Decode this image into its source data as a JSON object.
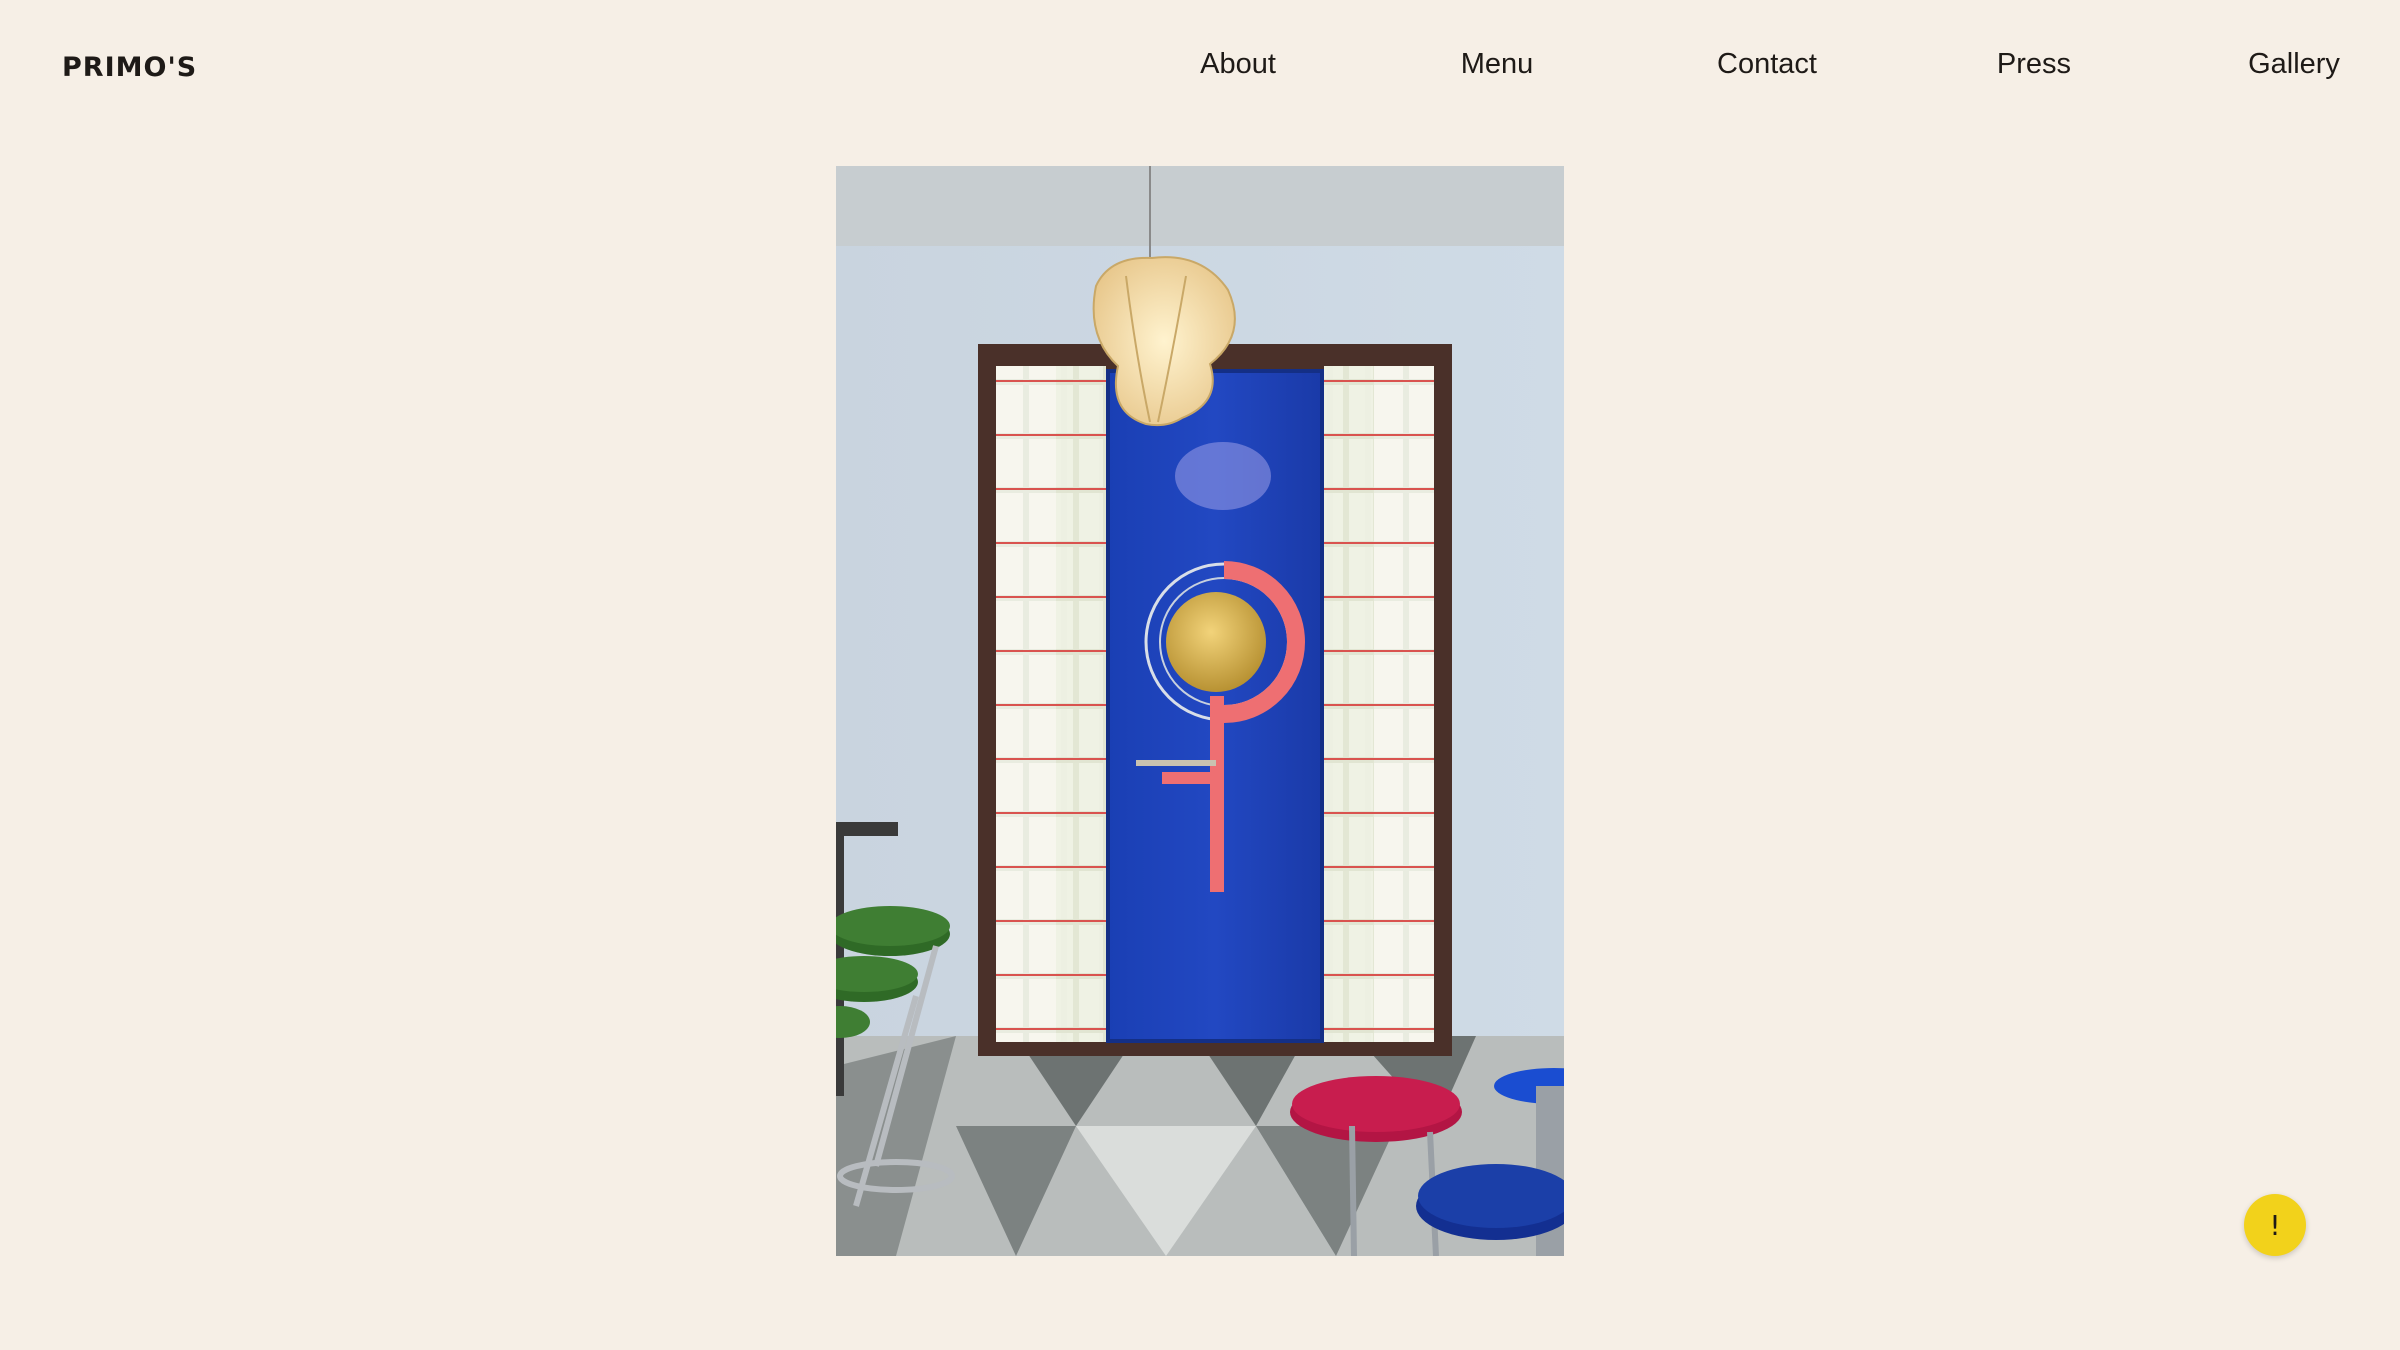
{
  "brand": {
    "name": "PRIMO'S"
  },
  "nav": {
    "items": [
      {
        "label": "About"
      },
      {
        "label": "Menu"
      },
      {
        "label": "Contact"
      },
      {
        "label": "Press"
      },
      {
        "label": "Gallery"
      }
    ]
  },
  "alert_button": {
    "label": "!",
    "color": "#f2d21b"
  },
  "colors": {
    "background": "#f6efe6",
    "text": "#1e1a17",
    "door_blue": "#1f43b8",
    "accent_pink": "#ee6f72"
  }
}
